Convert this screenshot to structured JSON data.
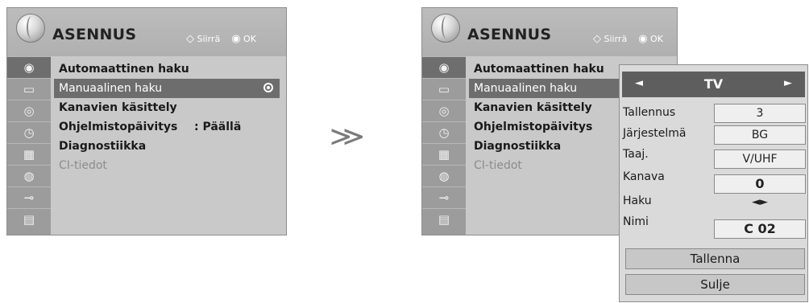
{
  "menu": {
    "title": "ASENNUS",
    "nav_hint": {
      "move_symbol": "◇",
      "move_label": "Siirrä",
      "ok_symbol": "◉",
      "ok_label": "OK"
    },
    "category_icons": [
      "satellite-icon",
      "screen-icon",
      "audio-icon",
      "clock-icon",
      "calendar-icon",
      "lock-icon",
      "input-icon",
      "movie-icon"
    ],
    "items": [
      {
        "label": "Automaattinen haku",
        "value": "",
        "state": "normal"
      },
      {
        "label": "Manuaalinen haku",
        "value": "",
        "state": "selected"
      },
      {
        "label": "Kanavien käsittely",
        "value": "",
        "state": "normal"
      },
      {
        "label": "Ohjelmistopäivitys",
        "value": ": Päällä",
        "state": "normal"
      },
      {
        "label": "Diagnostiikka",
        "value": "",
        "state": "normal"
      },
      {
        "label": "CI-tiedot",
        "value": "",
        "state": "disabled"
      }
    ]
  },
  "separator": "≫",
  "manual_tuning": {
    "mode": "TV",
    "nav_left": "◄",
    "nav_right": "►",
    "fields": {
      "store": {
        "label": "Tallennus",
        "value": "3"
      },
      "system": {
        "label": "Järjestelmä",
        "value": "BG"
      },
      "band": {
        "label": "Taaj.",
        "value": "V/UHF"
      },
      "channel": {
        "label": "Kanava",
        "value": "0"
      },
      "search": {
        "label": "Haku",
        "value": "◄►"
      },
      "name": {
        "label": "Nimi",
        "value": "C 02"
      }
    },
    "store_button": "Tallenna",
    "close_button": "Sulje"
  }
}
